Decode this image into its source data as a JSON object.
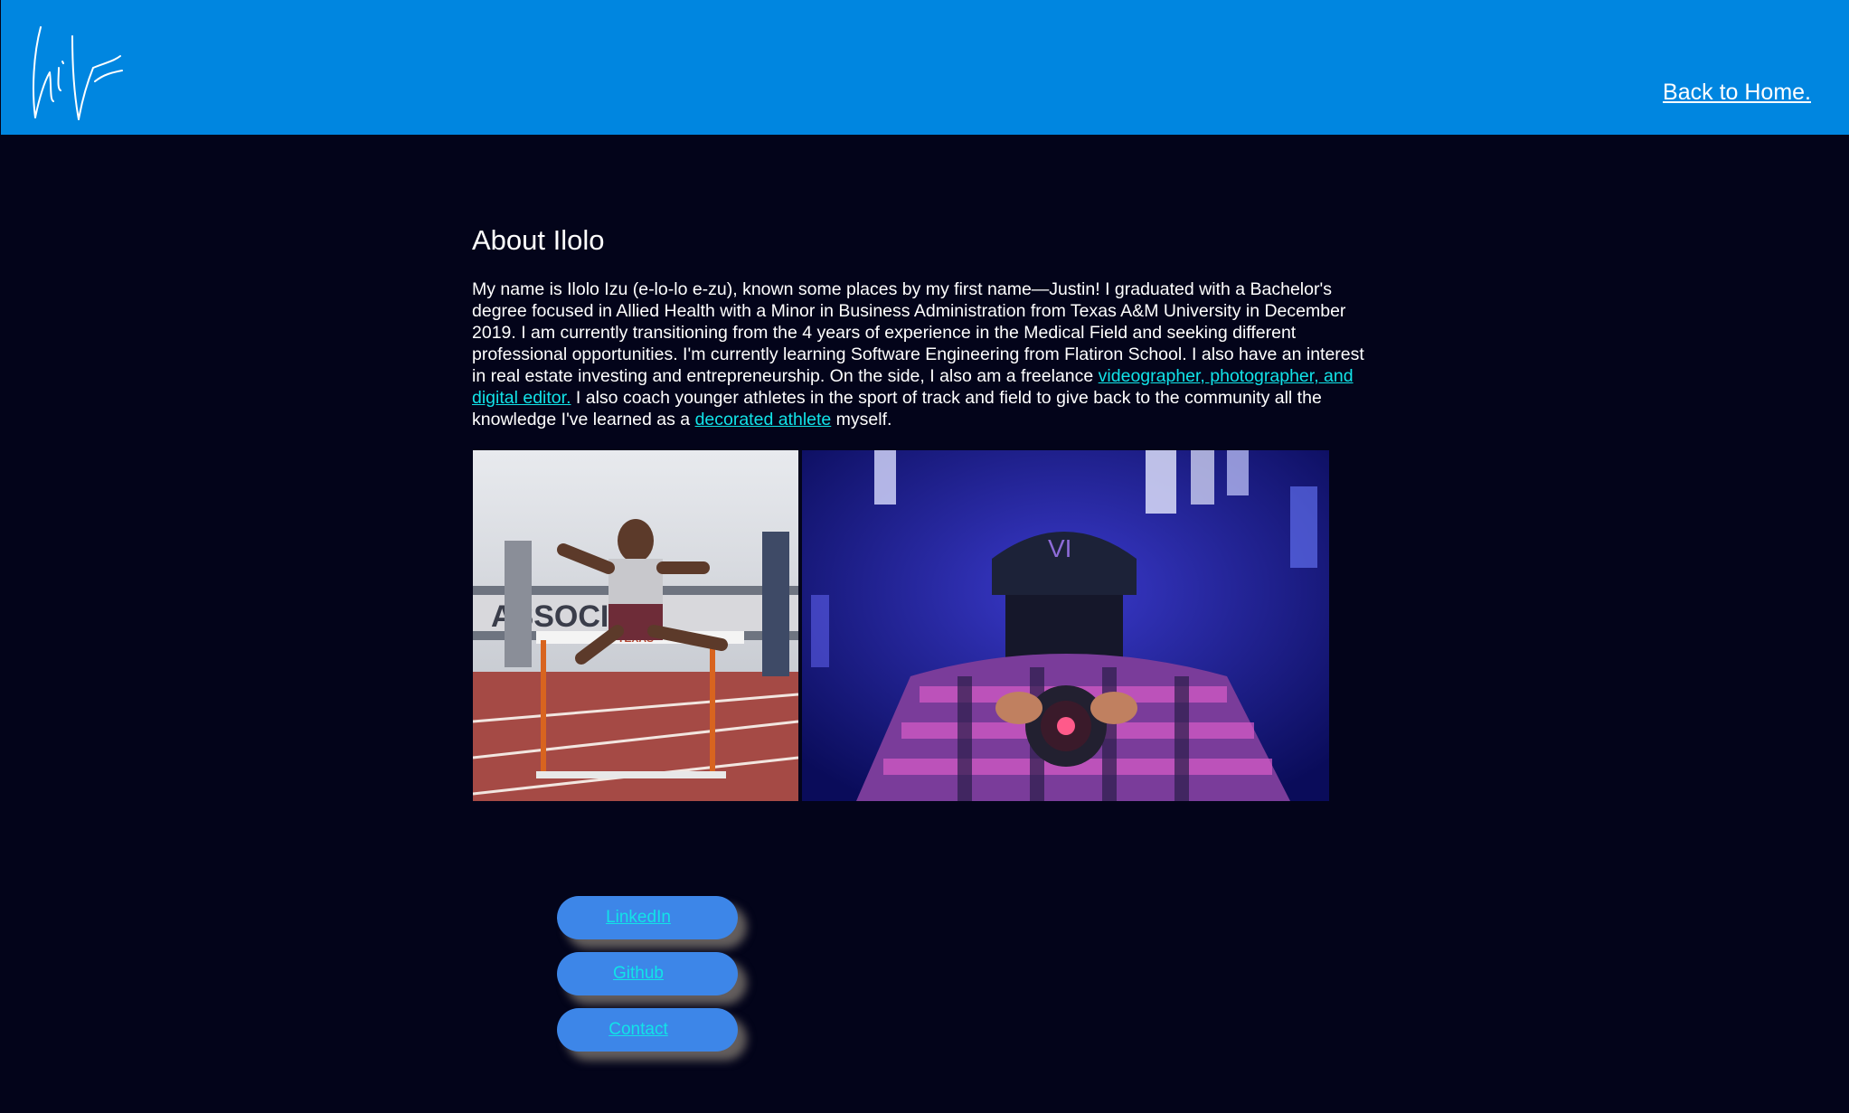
{
  "header": {
    "back_link": "Back to Home.",
    "background": "#0086e0"
  },
  "about": {
    "title": "About Ilolo",
    "text_1": "My name is Ilolo Izu (e-lo-lo e-zu), known some places by my first name—Justin! I graduated with a Bachelor's degree focused in Allied Health with a Minor in Business Administration from Texas A&M University in December 2019. I am currently transitioning from the 4 years of experience in the Medical Field and seeking different professional opportunities. I'm currently learning Software Engineering from Flatiron School. I also have an interest in real estate investing and entrepreneurship. On the side, I also am a freelance ",
    "link_1": "videographer, photographer, and digital editor.",
    "text_2": " I also coach younger athletes in the sport of track and field to give back to the community all the knowledge I've learned as a ",
    "link_2": "decorated athlete",
    "text_3": " myself."
  },
  "photos": [
    {
      "name": "hurdler-photo",
      "description_icon": "athlete-image"
    },
    {
      "name": "photographer-photo",
      "description_icon": "camera-image"
    }
  ],
  "social": {
    "linkedin": "LinkedIn",
    "github": "Github",
    "contact": "Contact"
  },
  "colors": {
    "page_bg": "#03041a",
    "link": "#12e3e8",
    "pill": "#3d86e8"
  }
}
